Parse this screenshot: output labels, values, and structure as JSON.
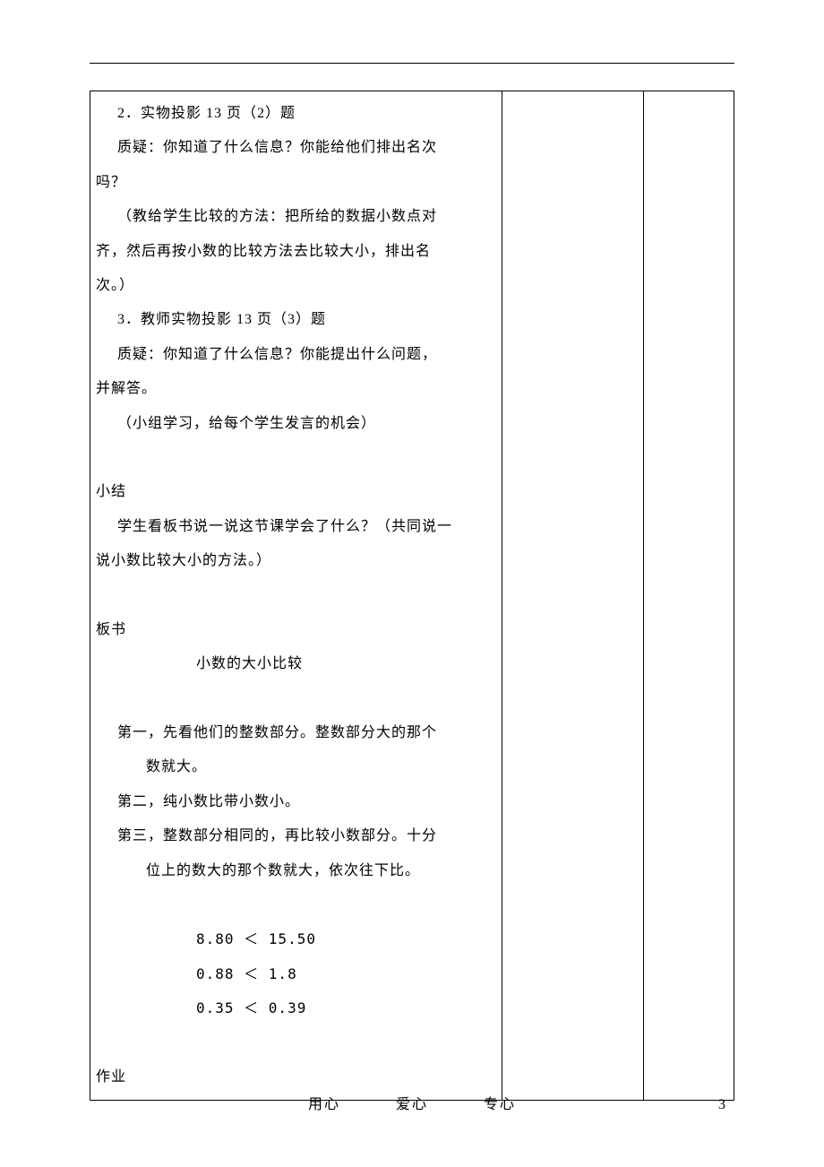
{
  "main": {
    "lines": [
      {
        "cls": "indent1",
        "text": "2．实物投影 13 页（2）题"
      },
      {
        "cls": "indent1",
        "text": "质疑：你知道了什么信息？你能给他们排出名次"
      },
      {
        "cls": "noindent",
        "text": "吗？"
      },
      {
        "cls": "indent1",
        "text": "（教给学生比较的方法：把所给的数据小数点对"
      },
      {
        "cls": "noindent",
        "text": "齐，然后再按小数的比较方法去比较大小，排出名"
      },
      {
        "cls": "noindent",
        "text": "次。）"
      },
      {
        "cls": "indent1",
        "text": "3．教师实物投影 13 页（3）题"
      },
      {
        "cls": "indent1",
        "text": "质疑：你知道了什么信息？你能提出什么问题，"
      },
      {
        "cls": "noindent",
        "text": "并解答。"
      },
      {
        "cls": "indent1",
        "text": "（小组学习，给每个学生发言的机会）"
      },
      {
        "cls": "noindent",
        "text": " "
      },
      {
        "cls": "noindent",
        "text": "小结"
      },
      {
        "cls": "indent1",
        "text": "学生看板书说一说这节课学会了什么？（共同说一"
      },
      {
        "cls": "noindent",
        "text": "说小数比较大小的方法。）"
      },
      {
        "cls": "noindent",
        "text": " "
      },
      {
        "cls": "noindent",
        "text": "板书"
      },
      {
        "cls": "center-title",
        "text": "小数的大小比较"
      },
      {
        "cls": "noindent",
        "text": " "
      },
      {
        "cls": "indent1",
        "text": "第一，先看他们的整数部分。整数部分大的那个"
      },
      {
        "cls": "indent4",
        "text": "数就大。"
      },
      {
        "cls": "indent1",
        "text": "第二，纯小数比带小数小。"
      },
      {
        "cls": "indent1",
        "text": "第三，整数部分相同的，再比较小数部分。十分"
      },
      {
        "cls": "indent4",
        "text": "位上的数大的那个数就大，依次往下比。"
      },
      {
        "cls": "noindent",
        "text": " "
      },
      {
        "cls": "comp-line",
        "text": "8.80  ＜  15.50"
      },
      {
        "cls": "comp-line",
        "text": "0.88  ＜  1.8"
      },
      {
        "cls": "comp-line",
        "text": "0.35  ＜   0.39"
      },
      {
        "cls": "noindent",
        "text": " "
      },
      {
        "cls": "noindent",
        "text": "作业"
      }
    ]
  },
  "footer": {
    "w1": "用心",
    "w2": "爱心",
    "w3": "专心"
  },
  "page_number": "3"
}
